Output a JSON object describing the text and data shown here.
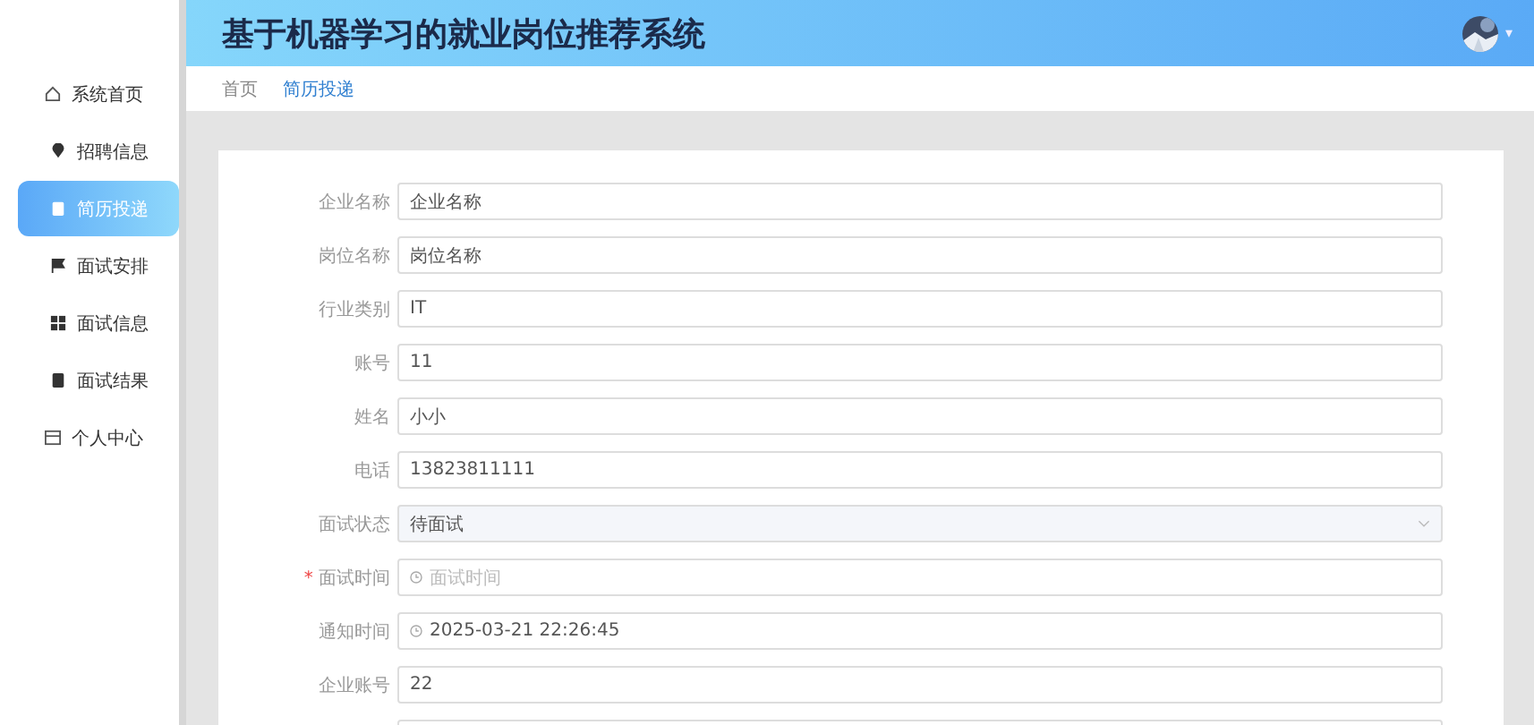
{
  "header": {
    "title": "基于机器学习的就业岗位推荐系统",
    "menu_caret": "▾"
  },
  "sidebar": {
    "items": [
      {
        "label": "系统首页",
        "selected": false,
        "kind": "top"
      },
      {
        "label": "招聘信息",
        "selected": false,
        "kind": "sub"
      },
      {
        "label": "简历投递",
        "selected": true,
        "kind": "sub"
      },
      {
        "label": "面试安排",
        "selected": false,
        "kind": "sub"
      },
      {
        "label": "面试信息",
        "selected": false,
        "kind": "sub"
      },
      {
        "label": "面试结果",
        "selected": false,
        "kind": "sub"
      },
      {
        "label": "个人中心",
        "selected": false,
        "kind": "top"
      }
    ]
  },
  "breadcrumb": [
    {
      "label": "首页",
      "selected": false
    },
    {
      "label": "简历投递",
      "selected": true
    }
  ],
  "form": {
    "fields": [
      {
        "kind": "text",
        "label": "企业名称",
        "value": "企业名称"
      },
      {
        "kind": "text",
        "label": "岗位名称",
        "value": "岗位名称"
      },
      {
        "kind": "text",
        "label": "行业类别",
        "value": "IT"
      },
      {
        "kind": "text",
        "label": "账号",
        "value": "11"
      },
      {
        "kind": "text",
        "label": "姓名",
        "value": "小小"
      },
      {
        "kind": "text",
        "label": "电话",
        "value": "13823811111"
      },
      {
        "kind": "select",
        "label": "面试状态",
        "value": "待面试"
      },
      {
        "kind": "date",
        "label": "面试时间",
        "placeholder": "面试时间",
        "required_mark": "*"
      },
      {
        "kind": "date",
        "label": "通知时间",
        "value": "2025-03-21 22:26:45"
      },
      {
        "kind": "text",
        "label": "企业账号",
        "value": "22"
      },
      {
        "kind": "text"
      }
    ]
  }
}
